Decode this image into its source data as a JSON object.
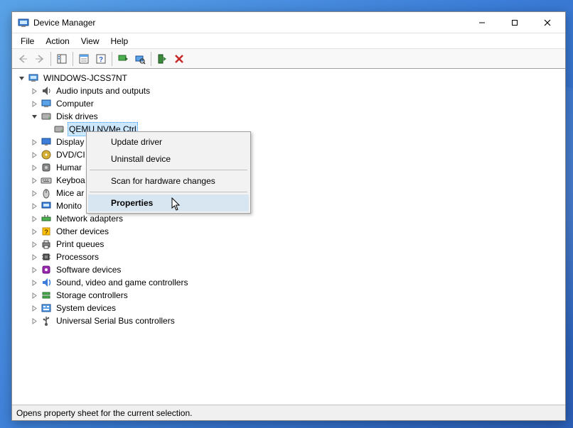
{
  "window": {
    "title": "Device Manager",
    "buttons": {
      "min": "—",
      "max": "▢",
      "close": "✕"
    }
  },
  "menubar": [
    "File",
    "Action",
    "View",
    "Help"
  ],
  "statusbar": "Opens property sheet for the current selection.",
  "tree": {
    "root": "WINDOWS-JCSS7NT",
    "categories": [
      {
        "label": "Audio inputs and outputs",
        "icon": "audio",
        "expander": "closed"
      },
      {
        "label": "Computer",
        "icon": "computer",
        "expander": "closed"
      },
      {
        "label": "Disk drives",
        "icon": "disk",
        "expander": "open",
        "children": [
          {
            "label": "QEMU NVMe Ctrl",
            "icon": "disk",
            "selected": true
          }
        ]
      },
      {
        "label": "Display adapters",
        "icon": "display",
        "expander": "closed",
        "truncated": "Display"
      },
      {
        "label": "DVD/CD-ROM drives",
        "icon": "dvd",
        "expander": "closed",
        "truncated": "DVD/CI"
      },
      {
        "label": "Human Interface Devices",
        "icon": "hid",
        "expander": "closed",
        "truncated": "Humar"
      },
      {
        "label": "Keyboards",
        "icon": "keyboard",
        "expander": "closed",
        "truncated": "Keyboa"
      },
      {
        "label": "Mice and other pointing devices",
        "icon": "mouse",
        "expander": "closed",
        "truncated": "Mice ar"
      },
      {
        "label": "Monitors",
        "icon": "monitor",
        "expander": "closed",
        "truncated": "Monito"
      },
      {
        "label": "Network adapters",
        "icon": "network",
        "expander": "closed"
      },
      {
        "label": "Other devices",
        "icon": "other",
        "expander": "closed"
      },
      {
        "label": "Print queues",
        "icon": "print",
        "expander": "closed"
      },
      {
        "label": "Processors",
        "icon": "cpu",
        "expander": "closed"
      },
      {
        "label": "Software devices",
        "icon": "software",
        "expander": "closed"
      },
      {
        "label": "Sound, video and game controllers",
        "icon": "sound",
        "expander": "closed"
      },
      {
        "label": "Storage controllers",
        "icon": "storage",
        "expander": "closed"
      },
      {
        "label": "System devices",
        "icon": "system",
        "expander": "closed"
      },
      {
        "label": "Universal Serial Bus controllers",
        "icon": "usb",
        "expander": "closed"
      }
    ]
  },
  "context_menu": {
    "items": [
      {
        "label": "Update driver"
      },
      {
        "label": "Uninstall device"
      },
      {
        "sep": true
      },
      {
        "label": "Scan for hardware changes"
      },
      {
        "sep": true
      },
      {
        "label": "Properties",
        "bold": true,
        "hover": true
      }
    ]
  }
}
